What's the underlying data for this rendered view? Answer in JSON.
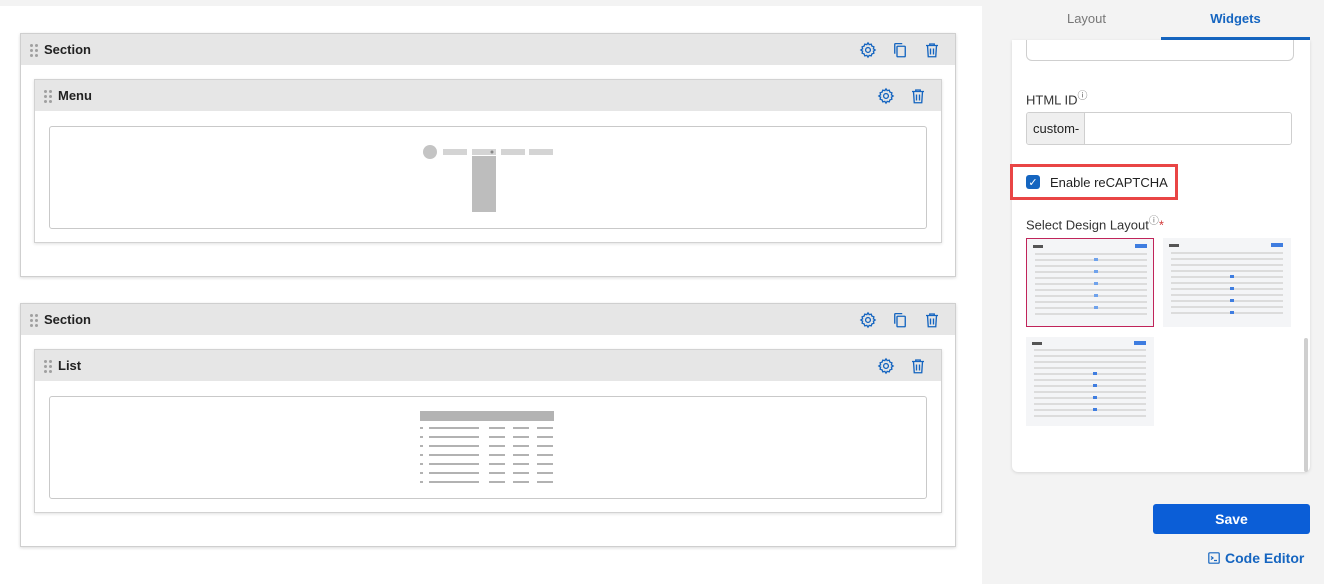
{
  "canvas": {
    "sections": [
      {
        "label": "Section",
        "widget": {
          "label": "Menu",
          "preview": "menu"
        }
      },
      {
        "label": "Section",
        "widget": {
          "label": "List",
          "preview": "list"
        }
      }
    ]
  },
  "panel": {
    "tabs": [
      {
        "label": "Layout",
        "active": false
      },
      {
        "label": "Widgets",
        "active": true
      }
    ],
    "html_id": {
      "label": "HTML ID",
      "prefix": "custom-",
      "value": ""
    },
    "recaptcha": {
      "label": "Enable reCAPTCHA",
      "checked": true
    },
    "design_layout": {
      "label": "Select Design Layout",
      "required_mark": "*",
      "selected_index": 0,
      "option_count": 3
    },
    "save_label": "Save",
    "code_editor_label": "Code Editor"
  },
  "icons": {
    "settings": "gear-icon",
    "copy": "copy-icon",
    "delete": "trash-icon",
    "drag": "drag-handle-icon",
    "help": "help-circle-icon",
    "code": "terminal-icon"
  },
  "colors": {
    "accent": "#1565c0",
    "highlight": "#e94545",
    "selected_thumb": "#c0245a",
    "save_button": "#0b5ed7"
  }
}
